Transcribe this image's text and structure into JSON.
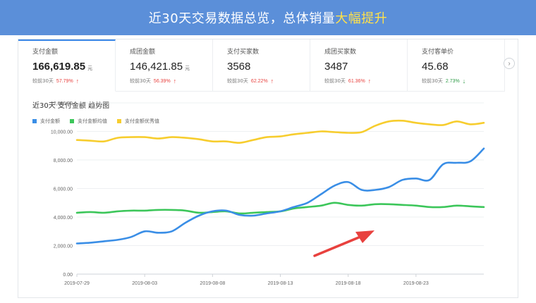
{
  "banner": {
    "title_prefix": "近30天交易数据总览，总体销量",
    "title_highlight": "大幅提升"
  },
  "kpis": [
    {
      "label": "支付金额",
      "value": "166,619.85",
      "unit": "元",
      "compare_label": "较前30天",
      "pct": "57.79%",
      "trend": "up",
      "active": true
    },
    {
      "label": "成团金额",
      "value": "146,421.85",
      "unit": "元",
      "compare_label": "较前30天",
      "pct": "56.39%",
      "trend": "up",
      "active": false
    },
    {
      "label": "支付买家数",
      "value": "3568",
      "unit": "",
      "compare_label": "较前30天",
      "pct": "62.22%",
      "trend": "up",
      "active": false
    },
    {
      "label": "成团买家数",
      "value": "3487",
      "unit": "",
      "compare_label": "较前30天",
      "pct": "61.36%",
      "trend": "up",
      "active": false
    },
    {
      "label": "支付客单价",
      "value": "45.68",
      "unit": "",
      "compare_label": "较前30天",
      "pct": "2.73%",
      "trend": "down",
      "active": false
    }
  ],
  "nav": {
    "next_icon": "chevron-right-icon",
    "next_glyph": "›"
  },
  "chart_title": "近30天 支付金额 趋势图",
  "colors": {
    "accent": "#3a86e6",
    "up": "#e8413e",
    "down": "#2e9b47",
    "series": [
      "#3a8ee6",
      "#3cc65a",
      "#f7cd2e"
    ],
    "arrow": "#e8413e"
  },
  "chart_data": {
    "type": "line",
    "title": "近30天 支付金额 趋势图",
    "xlabel": "",
    "ylabel": "",
    "ylim": [
      0,
      12000
    ],
    "yticks": [
      "0.00",
      "2,000.00",
      "4,000.00",
      "6,000.00",
      "8,000.00",
      "10,000.00",
      "12,000.00"
    ],
    "grid": true,
    "legend_position": "top-left",
    "x_tick_labels": [
      "2019-07-29",
      "2019-08-03",
      "2019-08-08",
      "2019-08-13",
      "2019-08-18",
      "2019-08-23"
    ],
    "x": [
      "2019-07-29",
      "2019-07-30",
      "2019-07-31",
      "2019-08-01",
      "2019-08-02",
      "2019-08-03",
      "2019-08-04",
      "2019-08-05",
      "2019-08-06",
      "2019-08-07",
      "2019-08-08",
      "2019-08-09",
      "2019-08-10",
      "2019-08-11",
      "2019-08-12",
      "2019-08-13",
      "2019-08-14",
      "2019-08-15",
      "2019-08-16",
      "2019-08-17",
      "2019-08-18",
      "2019-08-19",
      "2019-08-20",
      "2019-08-21",
      "2019-08-22",
      "2019-08-23",
      "2019-08-24",
      "2019-08-25",
      "2019-08-26",
      "2019-08-27"
    ],
    "series": [
      {
        "name": "支付金额",
        "values": [
          2150,
          2200,
          2300,
          2400,
          2600,
          3000,
          2900,
          3000,
          3600,
          4100,
          4400,
          4450,
          4150,
          4100,
          4250,
          4400,
          4700,
          5000,
          5600,
          6200,
          6450,
          5900,
          5900,
          6100,
          6600,
          6700,
          6600,
          7700,
          7800,
          7900,
          8800
        ]
      },
      {
        "name": "支付金额均值",
        "values": [
          4300,
          4350,
          4300,
          4400,
          4450,
          4450,
          4500,
          4500,
          4450,
          4300,
          4350,
          4400,
          4250,
          4300,
          4350,
          4400,
          4600,
          4700,
          4800,
          5000,
          4850,
          4800,
          4900,
          4900,
          4850,
          4800,
          4700,
          4700,
          4800,
          4750,
          4700
        ]
      },
      {
        "name": "支付金额优秀值",
        "values": [
          9400,
          9350,
          9300,
          9550,
          9600,
          9600,
          9500,
          9600,
          9550,
          9450,
          9300,
          9300,
          9200,
          9400,
          9600,
          9650,
          9800,
          9900,
          10000,
          9950,
          9900,
          9950,
          10400,
          10700,
          10750,
          10600,
          10500,
          10450,
          10700,
          10500,
          10600
        ]
      }
    ]
  }
}
